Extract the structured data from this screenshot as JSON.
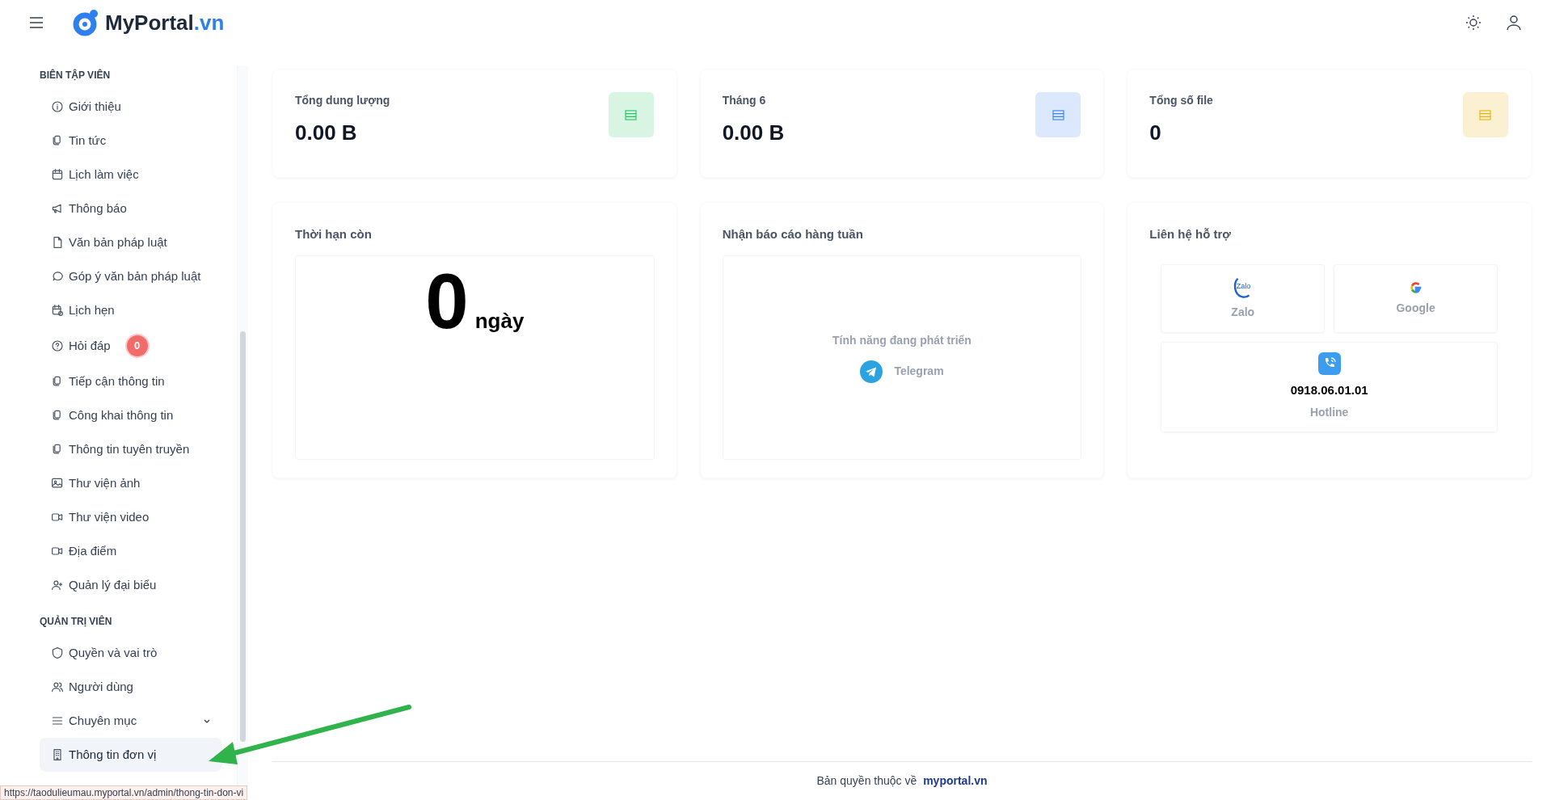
{
  "header": {
    "logo": {
      "name": "MyPortal",
      "suffix": ".vn"
    }
  },
  "sidebar": {
    "sections": [
      {
        "title": "BIÊN TẬP VIÊN",
        "items": [
          {
            "label": "Giới thiệu",
            "selected": false
          },
          {
            "label": "Tin tức",
            "selected": false
          },
          {
            "label": "Lịch làm việc",
            "selected": false
          },
          {
            "label": "Thông báo",
            "selected": false
          },
          {
            "label": "Văn bản pháp luật",
            "selected": false
          },
          {
            "label": "Góp ý văn bản pháp luật",
            "selected": false
          },
          {
            "label": "Lịch hẹn",
            "selected": false
          },
          {
            "label": "Hỏi đáp",
            "selected": false,
            "badge": "0"
          },
          {
            "label": "Tiếp cận thông tin",
            "selected": false
          },
          {
            "label": "Công khai thông tin",
            "selected": false
          },
          {
            "label": "Thông tin tuyên truyền",
            "selected": false
          },
          {
            "label": "Thư viện ảnh",
            "selected": false
          },
          {
            "label": "Thư viện video",
            "selected": false
          },
          {
            "label": "Địa điểm",
            "selected": false
          },
          {
            "label": "Quản lý đại biểu",
            "selected": false
          }
        ]
      },
      {
        "title": "QUẢN TRỊ VIÊN",
        "items": [
          {
            "label": "Quyền và vai trò",
            "selected": false
          },
          {
            "label": "Người dùng",
            "selected": false
          },
          {
            "label": "Chuyên mục",
            "selected": false,
            "expanded": false
          },
          {
            "label": "Thông tin đơn vị",
            "selected": true
          }
        ]
      }
    ]
  },
  "stats": [
    {
      "label": "Tổng dung lượng",
      "value": "0.00 B",
      "color": "#22c55e"
    },
    {
      "label": "Tháng 6",
      "value": "0.00 B",
      "color": "#3b82f6"
    },
    {
      "label": "Tổng số file",
      "value": "0",
      "color": "#eab308"
    }
  ],
  "remaining": {
    "title": "Thời hạn còn",
    "value": "0",
    "unit": "ngày"
  },
  "weekly_report": {
    "title": "Nhận báo cáo hàng tuần",
    "message": "Tính năng đang phát triển",
    "channel": "Telegram"
  },
  "support": {
    "title": "Liên hệ hỗ trợ",
    "contacts": [
      {
        "kind": "zalo",
        "logo_text": "Zalo",
        "label": "Zalo"
      },
      {
        "kind": "google",
        "label": "Google"
      },
      {
        "kind": "hotline",
        "number": "0918.06.01.01",
        "label": "Hotline"
      }
    ]
  },
  "footer": {
    "text": "Bản quyền thuộc về",
    "link": "myportal.vn"
  },
  "status_url": "https://taodulieumau.myportal.vn/admin/thong-tin-don-vi"
}
